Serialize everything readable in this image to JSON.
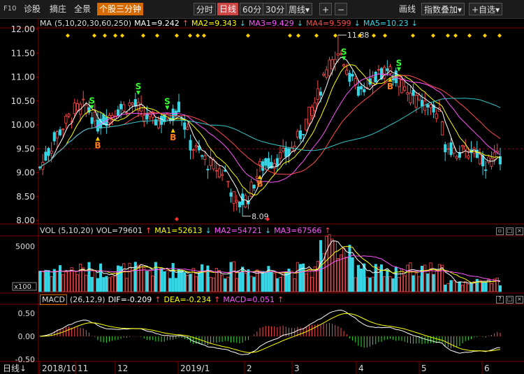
{
  "toolbar": {
    "f10": "F10",
    "items": [
      "诊股",
      "摘庄",
      "全景"
    ],
    "active": "个股三分钟",
    "periods": [
      "分时",
      "日线",
      "60分",
      "30分",
      "周线"
    ],
    "selected_period": "日线",
    "week_arrow": "▾",
    "plus": "+",
    "minus": "−",
    "draw": "画线",
    "overlay": "指数叠加",
    "overlay_arrow": "▾",
    "watch": "+自选",
    "watch_arrow": "▾"
  },
  "colors": {
    "up": "#ff4a4a",
    "down": "#35d6e6",
    "ma1": "#ffffff",
    "ma2": "#ffff00",
    "ma3": "#ff55ff",
    "ma4": "#ff4a4a",
    "ma5": "#35c6c6",
    "grid": "#800000"
  },
  "ma_legend": {
    "title": "MA",
    "params": "(5,10,20,30,60,250)",
    "ma1": "MA1=9.242",
    "ma2": "MA2=9.343",
    "ma3": "MA3=9.429",
    "ma4": "MA4=9.599",
    "ma5": "MA5=10.23"
  },
  "vol_legend": {
    "title": "VOL",
    "params": "(5,10,20)",
    "vol": "VOL=79601",
    "ma1": "MA1=52613",
    "ma2": "MA2=54721",
    "ma3": "MA3=67566"
  },
  "macd_legend": {
    "title": "MACD",
    "params": "(26,12,9)",
    "dif": "DIF=-0.209",
    "dea": "DEA=-0.234",
    "macd": "MACD=0.051"
  },
  "price_axis": {
    "ticks": [
      "12.00",
      "11.50",
      "11.00",
      "10.50",
      "10.00",
      "9.50",
      "9.00",
      "8.50",
      "8.00"
    ]
  },
  "vol_axis": {
    "ticks": [
      "5000"
    ],
    "unit": "x100"
  },
  "macd_axis": {
    "ticks": [
      "0.50",
      "0.00",
      "-0.50"
    ]
  },
  "x_axis": {
    "period": "日线",
    "labels": [
      "2018/10",
      "11",
      "12",
      "2019/1",
      "2",
      "3",
      "4",
      "5",
      "6"
    ]
  },
  "annotations": {
    "high": "11.88",
    "low": "8.09"
  },
  "chart_data": {
    "type": "candlestick",
    "price_range": [
      8.0,
      12.0
    ],
    "signals": [
      {
        "bar": 18,
        "label": "S"
      },
      {
        "bar": 34,
        "label": "S"
      },
      {
        "bar": 44,
        "label": "S"
      },
      {
        "bar": 105,
        "label": "S"
      },
      {
        "bar": 124,
        "label": "S"
      },
      {
        "bar": 20,
        "label": "B"
      },
      {
        "bar": 46,
        "label": "B"
      },
      {
        "bar": 76,
        "label": "B"
      },
      {
        "bar": 121,
        "label": "B"
      }
    ]
  }
}
